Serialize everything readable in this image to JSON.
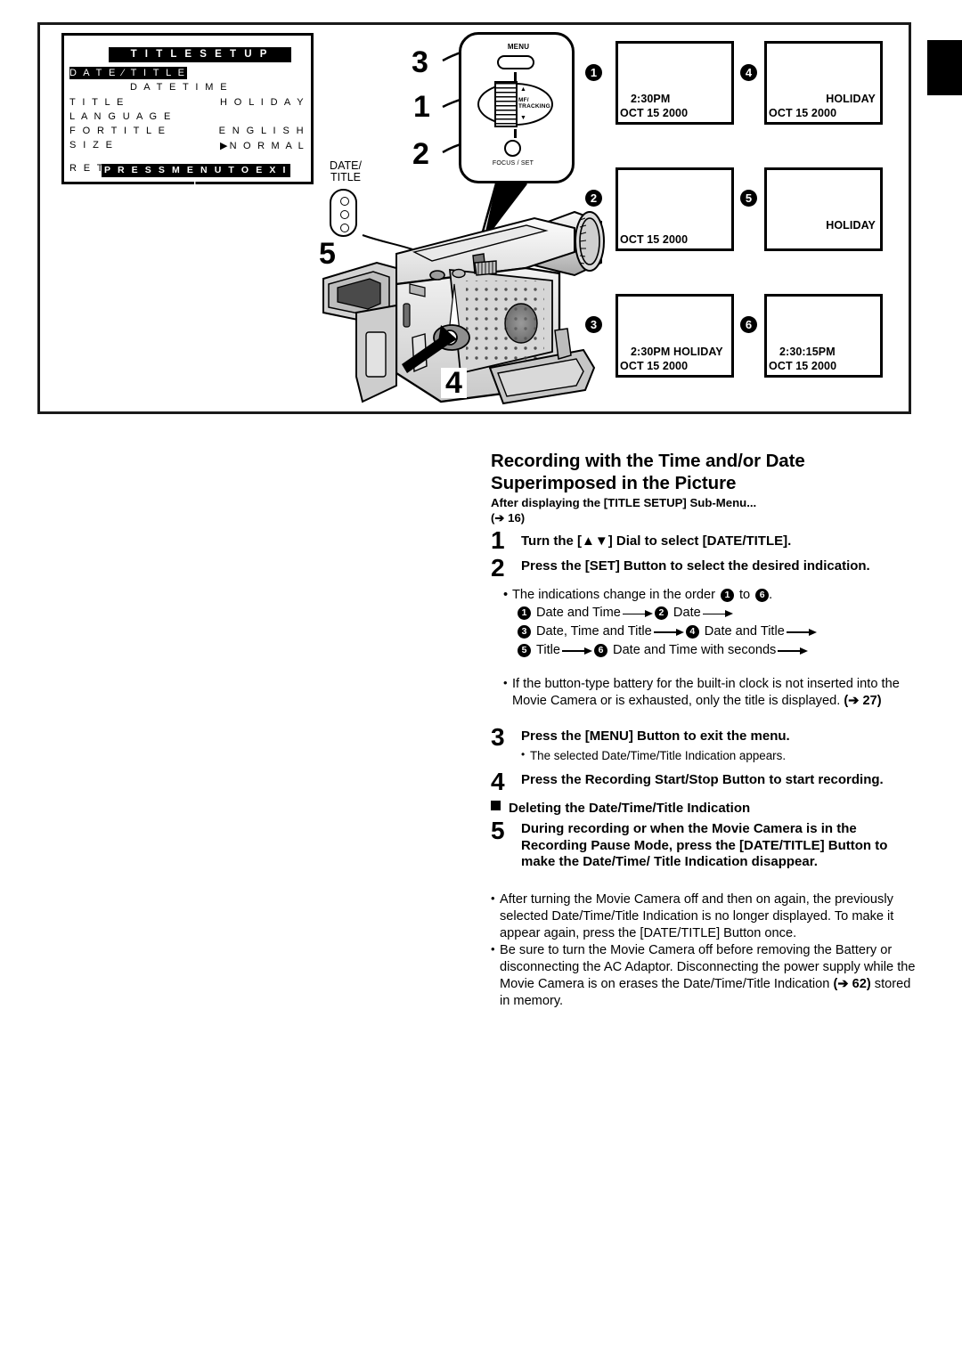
{
  "osd_menu": {
    "title": "T I T L E   S E T U P",
    "rows": [
      {
        "label": "D A T E ⁄ T I T L E",
        "highlight": true,
        "value": ""
      },
      {
        "label": "",
        "value": "D A T E   T I M E"
      },
      {
        "label": "T I T L E",
        "value": "H O L I D A Y"
      },
      {
        "label": "L A N G U A G E",
        "value": ""
      },
      {
        "label": "F O R   T I T L E",
        "value": "E N G L I S H"
      },
      {
        "label": "S I Z E",
        "value": "▶N O R M A L"
      },
      {
        "label": "R E T U R N",
        "value": "▶   – – – –"
      }
    ],
    "footer": "P R E S S   M E N U   T O   E X I T"
  },
  "callouts": {
    "dial_step_3": "3",
    "dial_step_1": "1",
    "dial_step_2": "2",
    "camera_step_5": "5",
    "camera_step_4": "4"
  },
  "balloon": {
    "menu_button_label": "MENU",
    "jog_dial_label": "MF/\nTRACKING",
    "jog_up_arrow": "▲",
    "jog_down_arrow": "▼",
    "focus_set_label": "FOCUS / SET"
  },
  "camera": {
    "date_title_button_label": "DATE/\nTITLE"
  },
  "indication_screens": [
    {
      "num": "❶",
      "marker": "1",
      "line1": "2:30PM",
      "line2": "OCT 15 2000",
      "align1": "left",
      "indent1": 14,
      "align2": "left"
    },
    {
      "num": "❷",
      "marker": "2",
      "line1": "",
      "line2": "OCT 15 2000",
      "align1": "left",
      "indent1": 0,
      "align2": "left"
    },
    {
      "num": "❸",
      "marker": "3",
      "line1": "2:30PM   HOLIDAY",
      "line2": "OCT 15 2000",
      "align1": "left",
      "indent1": 14,
      "align2": "left"
    },
    {
      "num": "❹",
      "marker": "4",
      "line1": "HOLIDAY",
      "line2": "OCT 15 2000",
      "align1": "right",
      "indent1": 0,
      "align2": "left"
    },
    {
      "num": "❺",
      "marker": "5",
      "line1": "HOLIDAY",
      "line2": "",
      "align1": "right",
      "indent1": 0,
      "align2": "left"
    },
    {
      "num": "❻",
      "marker": "6",
      "line1": "2:30:15PM",
      "line2": "OCT 15 2000",
      "align1": "left",
      "indent1": 14,
      "align2": "left"
    }
  ],
  "article": {
    "heading_line1": "Recording with the Time and/or Date",
    "heading_line2": "Superimposed in the Picture",
    "subhead_line1": "After displaying the [TITLE SETUP] Sub-Menu...",
    "subhead_line2": "(➔ 16)",
    "steps": [
      {
        "num": "1",
        "text": "Turn the [▲▼] Dial to select [DATE/TITLE]."
      },
      {
        "num": "2",
        "text": "Press the [SET] Button to select the desired indication."
      }
    ],
    "order_intro": "The indications change in the order",
    "order_intro_to": "to",
    "order_intro_end": ".",
    "order_intro_first": "1",
    "order_intro_last": "6",
    "order_rows": [
      [
        {
          "num": "1",
          "label": "Date and Time"
        },
        {
          "num": "2",
          "label": "Date"
        }
      ],
      [
        {
          "num": "3",
          "label": "Date, Time and Title"
        },
        {
          "num": "4",
          "label": "Date and Title"
        }
      ],
      [
        {
          "num": "5",
          "label": "Title"
        },
        {
          "num": "6",
          "label": "Date and Time with seconds"
        }
      ]
    ],
    "battery_note": "If the button-type battery for the built-in clock is not inserted into the Movie Camera or is exhausted, only the title is displayed.",
    "battery_note_ref": "(➔ 27)",
    "step3_num": "3",
    "step3_text": "Press the [MENU] Button to exit the menu.",
    "step3_bullet": "The selected Date/Time/Title Indication appears.",
    "step4_num": "4",
    "step4_text": "Press the Recording Start/Stop Button to start recording.",
    "section_heading": "Deleting the Date/Time/Title Indication",
    "step5_num": "5",
    "step5_text": "During recording or when the Movie Camera is in the Recording Pause Mode, press the [DATE/TITLE] Button to make the Date/Time/ Title Indication disappear.",
    "final_notes": [
      {
        "pre": "After turning the Movie Camera off and then on again, the previously selected Date/Time/Title Indication is no longer displayed. To make it appear again, press the [DATE/TITLE] Button once.",
        "ref": "",
        "post": ""
      },
      {
        "pre": "Be sure to turn the Movie Camera off before removing the Battery or disconnecting the AC Adaptor. Disconnecting the power supply while the Movie Camera is on erases the Date/Time/Title Indication ",
        "ref": "(➔ 62)",
        "post": " stored in memory."
      }
    ]
  }
}
